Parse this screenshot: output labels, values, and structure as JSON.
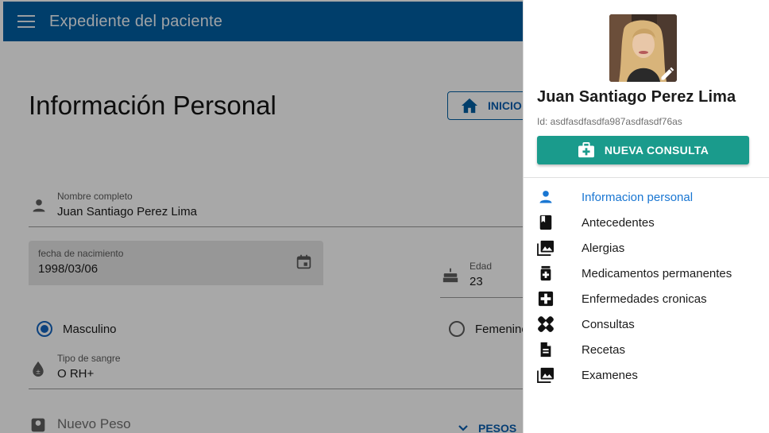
{
  "appbar": {
    "title": "Expediente del paciente",
    "menu_icon": "menu-icon"
  },
  "main": {
    "heading": "Información Personal",
    "home_button": "INICIO",
    "fields": {
      "nombre": {
        "label": "Nombre completo",
        "value": "Juan Santiago Perez Lima"
      },
      "fecha": {
        "label": "fecha de nacimiento",
        "value": "1998/03/06"
      },
      "edad": {
        "label": "Edad",
        "value": "23"
      },
      "sangre": {
        "label": "Tipo de sangre",
        "value": "O RH+"
      }
    },
    "gender": {
      "options": [
        "Masculino",
        "Femenino"
      ],
      "selected": "Masculino"
    },
    "peso_placeholder": "Nuevo Peso",
    "peso_button": "PESOS"
  },
  "drawer": {
    "patient_name": "Juan Santiago Perez Lima",
    "patient_id": "Id: asdfasdfasdfa987asdfasdf76as",
    "new_consult_button": "NUEVA CONSULTA",
    "nav": [
      {
        "label": "Informacion personal",
        "icon": "person-icon",
        "active": true
      },
      {
        "label": "Antecedentes",
        "icon": "book-icon",
        "active": false
      },
      {
        "label": "Alergias",
        "icon": "photo-library-icon",
        "active": false
      },
      {
        "label": "Medicamentos permanentes",
        "icon": "medication-icon",
        "active": false
      },
      {
        "label": "Enfermedades cronicas",
        "icon": "medical-cross-icon",
        "active": false
      },
      {
        "label": "Consultas",
        "icon": "bandage-icon",
        "active": false
      },
      {
        "label": "Recetas",
        "icon": "document-icon",
        "active": false
      },
      {
        "label": "Examenes",
        "icon": "photo-library-icon",
        "active": false
      }
    ]
  },
  "colors": {
    "primary": "#005fa3",
    "accent": "#1a9b8c",
    "active_nav": "#1976d2"
  }
}
